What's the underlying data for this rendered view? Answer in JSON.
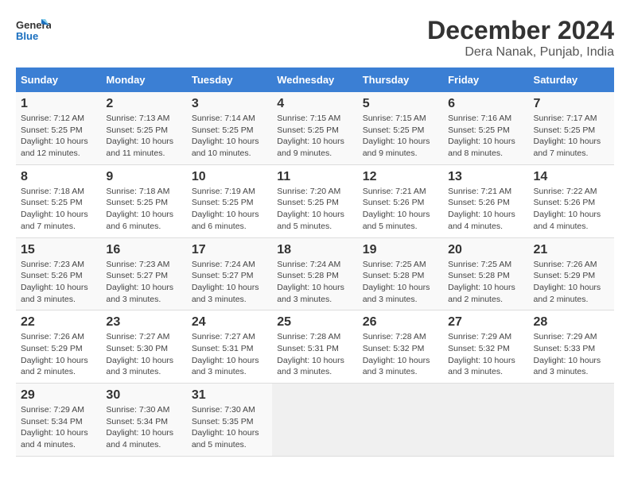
{
  "logo": {
    "line1": "General",
    "line2": "Blue"
  },
  "title": "December 2024",
  "subtitle": "Dera Nanak, Punjab, India",
  "days_of_week": [
    "Sunday",
    "Monday",
    "Tuesday",
    "Wednesday",
    "Thursday",
    "Friday",
    "Saturday"
  ],
  "weeks": [
    [
      {
        "day": 1,
        "info": "Sunrise: 7:12 AM\nSunset: 5:25 PM\nDaylight: 10 hours\nand 12 minutes."
      },
      {
        "day": 2,
        "info": "Sunrise: 7:13 AM\nSunset: 5:25 PM\nDaylight: 10 hours\nand 11 minutes."
      },
      {
        "day": 3,
        "info": "Sunrise: 7:14 AM\nSunset: 5:25 PM\nDaylight: 10 hours\nand 10 minutes."
      },
      {
        "day": 4,
        "info": "Sunrise: 7:15 AM\nSunset: 5:25 PM\nDaylight: 10 hours\nand 9 minutes."
      },
      {
        "day": 5,
        "info": "Sunrise: 7:15 AM\nSunset: 5:25 PM\nDaylight: 10 hours\nand 9 minutes."
      },
      {
        "day": 6,
        "info": "Sunrise: 7:16 AM\nSunset: 5:25 PM\nDaylight: 10 hours\nand 8 minutes."
      },
      {
        "day": 7,
        "info": "Sunrise: 7:17 AM\nSunset: 5:25 PM\nDaylight: 10 hours\nand 7 minutes."
      }
    ],
    [
      {
        "day": 8,
        "info": "Sunrise: 7:18 AM\nSunset: 5:25 PM\nDaylight: 10 hours\nand 7 minutes."
      },
      {
        "day": 9,
        "info": "Sunrise: 7:18 AM\nSunset: 5:25 PM\nDaylight: 10 hours\nand 6 minutes."
      },
      {
        "day": 10,
        "info": "Sunrise: 7:19 AM\nSunset: 5:25 PM\nDaylight: 10 hours\nand 6 minutes."
      },
      {
        "day": 11,
        "info": "Sunrise: 7:20 AM\nSunset: 5:25 PM\nDaylight: 10 hours\nand 5 minutes."
      },
      {
        "day": 12,
        "info": "Sunrise: 7:21 AM\nSunset: 5:26 PM\nDaylight: 10 hours\nand 5 minutes."
      },
      {
        "day": 13,
        "info": "Sunrise: 7:21 AM\nSunset: 5:26 PM\nDaylight: 10 hours\nand 4 minutes."
      },
      {
        "day": 14,
        "info": "Sunrise: 7:22 AM\nSunset: 5:26 PM\nDaylight: 10 hours\nand 4 minutes."
      }
    ],
    [
      {
        "day": 15,
        "info": "Sunrise: 7:23 AM\nSunset: 5:26 PM\nDaylight: 10 hours\nand 3 minutes."
      },
      {
        "day": 16,
        "info": "Sunrise: 7:23 AM\nSunset: 5:27 PM\nDaylight: 10 hours\nand 3 minutes."
      },
      {
        "day": 17,
        "info": "Sunrise: 7:24 AM\nSunset: 5:27 PM\nDaylight: 10 hours\nand 3 minutes."
      },
      {
        "day": 18,
        "info": "Sunrise: 7:24 AM\nSunset: 5:28 PM\nDaylight: 10 hours\nand 3 minutes."
      },
      {
        "day": 19,
        "info": "Sunrise: 7:25 AM\nSunset: 5:28 PM\nDaylight: 10 hours\nand 3 minutes."
      },
      {
        "day": 20,
        "info": "Sunrise: 7:25 AM\nSunset: 5:28 PM\nDaylight: 10 hours\nand 2 minutes."
      },
      {
        "day": 21,
        "info": "Sunrise: 7:26 AM\nSunset: 5:29 PM\nDaylight: 10 hours\nand 2 minutes."
      }
    ],
    [
      {
        "day": 22,
        "info": "Sunrise: 7:26 AM\nSunset: 5:29 PM\nDaylight: 10 hours\nand 2 minutes."
      },
      {
        "day": 23,
        "info": "Sunrise: 7:27 AM\nSunset: 5:30 PM\nDaylight: 10 hours\nand 3 minutes."
      },
      {
        "day": 24,
        "info": "Sunrise: 7:27 AM\nSunset: 5:31 PM\nDaylight: 10 hours\nand 3 minutes."
      },
      {
        "day": 25,
        "info": "Sunrise: 7:28 AM\nSunset: 5:31 PM\nDaylight: 10 hours\nand 3 minutes."
      },
      {
        "day": 26,
        "info": "Sunrise: 7:28 AM\nSunset: 5:32 PM\nDaylight: 10 hours\nand 3 minutes."
      },
      {
        "day": 27,
        "info": "Sunrise: 7:29 AM\nSunset: 5:32 PM\nDaylight: 10 hours\nand 3 minutes."
      },
      {
        "day": 28,
        "info": "Sunrise: 7:29 AM\nSunset: 5:33 PM\nDaylight: 10 hours\nand 3 minutes."
      }
    ],
    [
      {
        "day": 29,
        "info": "Sunrise: 7:29 AM\nSunset: 5:34 PM\nDaylight: 10 hours\nand 4 minutes."
      },
      {
        "day": 30,
        "info": "Sunrise: 7:30 AM\nSunset: 5:34 PM\nDaylight: 10 hours\nand 4 minutes."
      },
      {
        "day": 31,
        "info": "Sunrise: 7:30 AM\nSunset: 5:35 PM\nDaylight: 10 hours\nand 5 minutes."
      },
      null,
      null,
      null,
      null
    ]
  ]
}
